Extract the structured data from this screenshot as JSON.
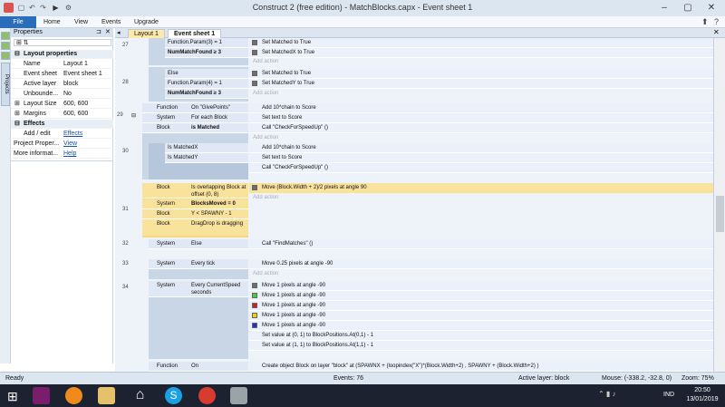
{
  "window": {
    "title": "Construct 2  (free edition) - MatchBlocks.capx - Event sheet 1"
  },
  "menu": {
    "file": "File",
    "home": "Home",
    "view": "View",
    "events": "Events",
    "upgrade": "Upgrade"
  },
  "lefttabs": [
    "Projects"
  ],
  "properties": {
    "title": "Properties",
    "section_layout": "Layout properties",
    "rows": [
      {
        "key": "Name",
        "value": "Layout 1"
      },
      {
        "key": "Event sheet",
        "value": "Event sheet 1"
      },
      {
        "key": "Active layer",
        "value": "block"
      },
      {
        "key": "Unbounde...",
        "value": "No"
      },
      {
        "key": "Layout Size",
        "value": "600, 600"
      },
      {
        "key": "Margins",
        "value": "600, 600"
      }
    ],
    "section_effects": "Effects",
    "links": [
      {
        "key": "Add / edit",
        "value": "Effects"
      },
      {
        "key": "Project Proper...",
        "value": "View"
      },
      {
        "key": "More informat...",
        "value": "Help"
      }
    ]
  },
  "tabs": {
    "layout": "Layout 1",
    "sheet": "Event sheet 1"
  },
  "events": {
    "e27": {
      "num": "27",
      "c1": "Function.Param(3) = 1",
      "c2": "NumMatchFound ≥ 3",
      "a1": "Set Matched to True",
      "a2": "Set MatchedX to True",
      "add": "Add action"
    },
    "e28": {
      "num": "28",
      "c0": "Else",
      "c1": "Function.Param(4) = 1",
      "c2": "NumMatchFound ≥ 3",
      "a1": "Set Matched to True",
      "a2": "Set MatchedY to True",
      "add": "Add action"
    },
    "e29": {
      "num": "29",
      "o1": "Function",
      "c1": "On \"GivePoints\"",
      "o2": "System",
      "c2": "For each Block",
      "o3": "Block",
      "c3": "is Matched",
      "a1": "Add 10*chain to Score",
      "a2": "Set text to Score",
      "a3": "Call \"CheckForSpeedUp\" ()",
      "add": "Add action"
    },
    "e30": {
      "num": "30",
      "c1": "Is MatchedX",
      "c2": "Is MatchedY",
      "a1": "Add 10*chain to Score",
      "a2": "Set text to Score",
      "a3": "Call \"CheckForSpeedUp\" ()"
    },
    "e31": {
      "num": "31",
      "o1": "Block",
      "c1": "Is overlapping Block at offset (0, 8)",
      "o2": "System",
      "c2": "BlocksMoved = 0",
      "o3": "Block",
      "c3": "Y < SPAWNY - 1",
      "o4": "Block",
      "c4": "DragDrop is dragging",
      "a1": "Move (Block.Width + 2)/2  pixels at angle 90",
      "add": "Add action"
    },
    "e32": {
      "num": "32",
      "o1": "System",
      "c1": "Else",
      "a1": "Call \"FindMatches\" ()"
    },
    "e33": {
      "num": "33",
      "o1": "System",
      "c1": "Every tick",
      "a1": "Move 0.25 pixels at angle -90",
      "add": "Add action"
    },
    "e34": {
      "num": "34",
      "o1": "System",
      "c1": "Every CurrentSpeed seconds",
      "a1": "Move 1 pixels at angle -90",
      "a2": "Move 1 pixels at angle -90",
      "a3": "Move 1 pixels at angle -90",
      "a4": "Move 1 pixels at angle -90",
      "a5": "Move 1 pixels at angle -90",
      "a6": "Set value at (0, 1) to BlockPositions.At(0,1) - 1",
      "a7": "Set value at (1, 1) to BlockPositions.At(1,1) - 1"
    },
    "e35": {
      "o1": "Function",
      "c1": "On",
      "a1": "Create object  Block on layer \"block\" at (SPAWNX + (loopindex(\"X\")*(Block.Width+2)  ,  SPAWNY + (Block.Width+2)  )"
    }
  },
  "swatch_colors": [
    "#6e6e6e",
    "#3ad13a",
    "#d62020",
    "#f2d000",
    "#1f2fd6"
  ],
  "status": {
    "ready": "Ready",
    "events": "Events: 76",
    "active_layer": "Active layer: block",
    "mouse": "Mouse: (-338.2, -32.8, 0)",
    "zoom": "Zoom: 75%"
  },
  "taskbar": {
    "lang": "IND",
    "time": "20:50",
    "date": "13/01/2019"
  }
}
